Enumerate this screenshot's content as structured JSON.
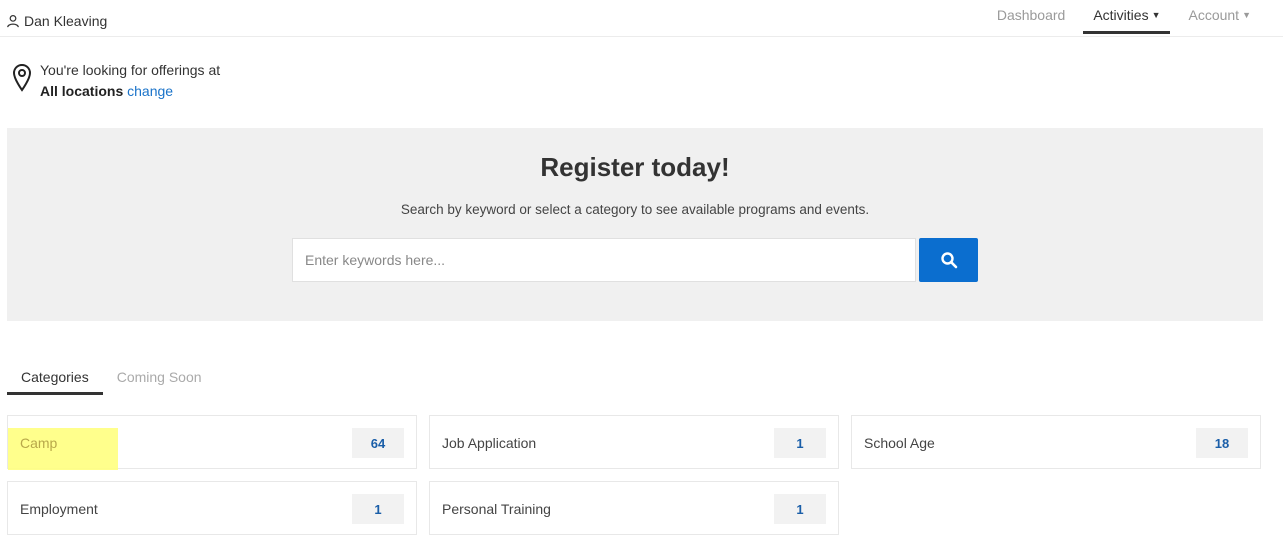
{
  "user": {
    "name": "Dan Kleaving",
    "icon": "user-icon"
  },
  "nav": {
    "dashboard": "Dashboard",
    "activities": "Activities",
    "account": "Account"
  },
  "location": {
    "line1": "You're looking for offerings at",
    "value": "All locations",
    "change": "change"
  },
  "hero": {
    "title": "Register today!",
    "subtitle": "Search by keyword or select a category to see available programs and events.",
    "search_placeholder": "Enter keywords here..."
  },
  "tabs": [
    "Categories",
    "Coming Soon"
  ],
  "categories": [
    {
      "name": "Camp",
      "count": "64"
    },
    {
      "name": "Job Application",
      "count": "1"
    },
    {
      "name": "School Age",
      "count": "18"
    },
    {
      "name": "Employment",
      "count": "1"
    },
    {
      "name": "Personal Training",
      "count": "1"
    }
  ],
  "colors": {
    "accent": "#0b6ecf",
    "link": "#1a73c9",
    "highlight": "#ffff80"
  }
}
